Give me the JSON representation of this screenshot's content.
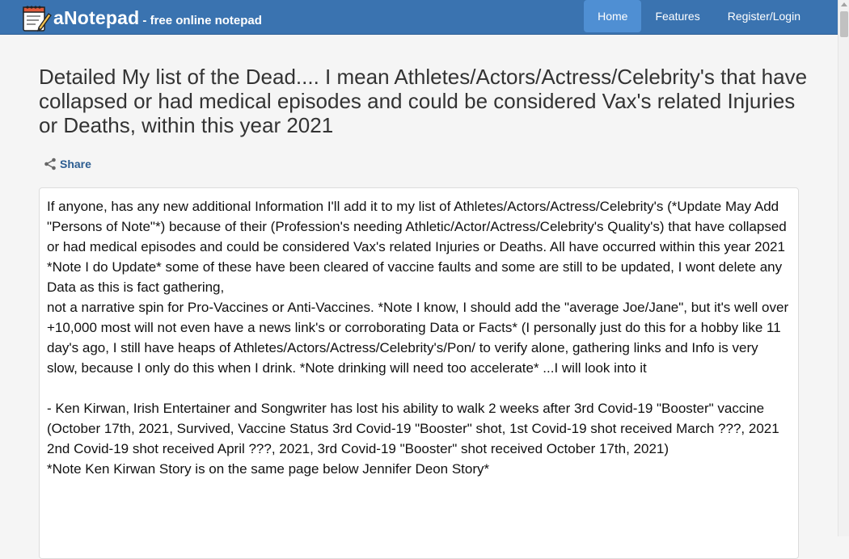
{
  "header": {
    "brand_name": "aNotepad",
    "brand_tagline": "- free online notepad",
    "nav": [
      {
        "label": "Home",
        "active": true
      },
      {
        "label": "Features",
        "active": false
      },
      {
        "label": "Register/Login",
        "active": false
      }
    ]
  },
  "note": {
    "title": "Detailed My list of the Dead.... I mean Athletes/Actors/Actress/Celebrity's that have collapsed or had medical episodes and could be considered Vax's related Injuries or Deaths, within this year 2021",
    "share_label": "Share",
    "lines": [
      "If anyone, has any new additional Information I'll add it to my list of Athletes/Actors/Actress/Celebrity's (*Update May Add \"Persons of Note\"*) because of their (Profession's needing Athletic/Actor/Actress/Celebrity's Quality's) that have collapsed or had medical episodes and could be considered Vax's related Injuries or Deaths. All have occurred within this year 2021 *Note I do Update* some of these have been cleared of vaccine faults and some are still to be updated, I wont delete any Data as this is fact gathering,",
      "not a narrative spin for Pro-Vaccines or Anti-Vaccines. *Note I know, I should add the \"average Joe/Jane\", but it's well over +10,000 most will not even have a news link's or corroborating Data or Facts* (I personally just do this for a hobby like 11 day's ago, I still have heaps of  Athletes/Actors/Actress/Celebrity's/Pon/ to verify alone, gathering links and Info is very slow, because I only do this when I drink. *Note drinking will need too accelerate* ...I will look into it",
      "",
      "- Ken Kirwan, Irish Entertainer and Songwriter has lost his ability to walk 2 weeks after 3rd Covid-19 \"Booster\" vaccine",
      "(October 17th, 2021, Survived, Vaccine Status 3rd Covid-19 \"Booster\" shot, 1st Covid-19 shot received March ???, 2021",
      "2nd Covid-19 shot received April ???, 2021, 3rd Covid-19 \"Booster\" shot received October 17th, 2021)",
      "*Note Ken Kirwan Story is on the same page below Jennifer Deon Story*"
    ]
  },
  "colors": {
    "navbar": "#3a73b0",
    "nav_active": "#4f8fd3",
    "page_bg": "#f5f5f5",
    "link": "#2c5d91"
  },
  "icons": {
    "logo": "notepad-pencil-icon",
    "share": "share-icon",
    "scroll_up": "triangle-up-icon"
  }
}
